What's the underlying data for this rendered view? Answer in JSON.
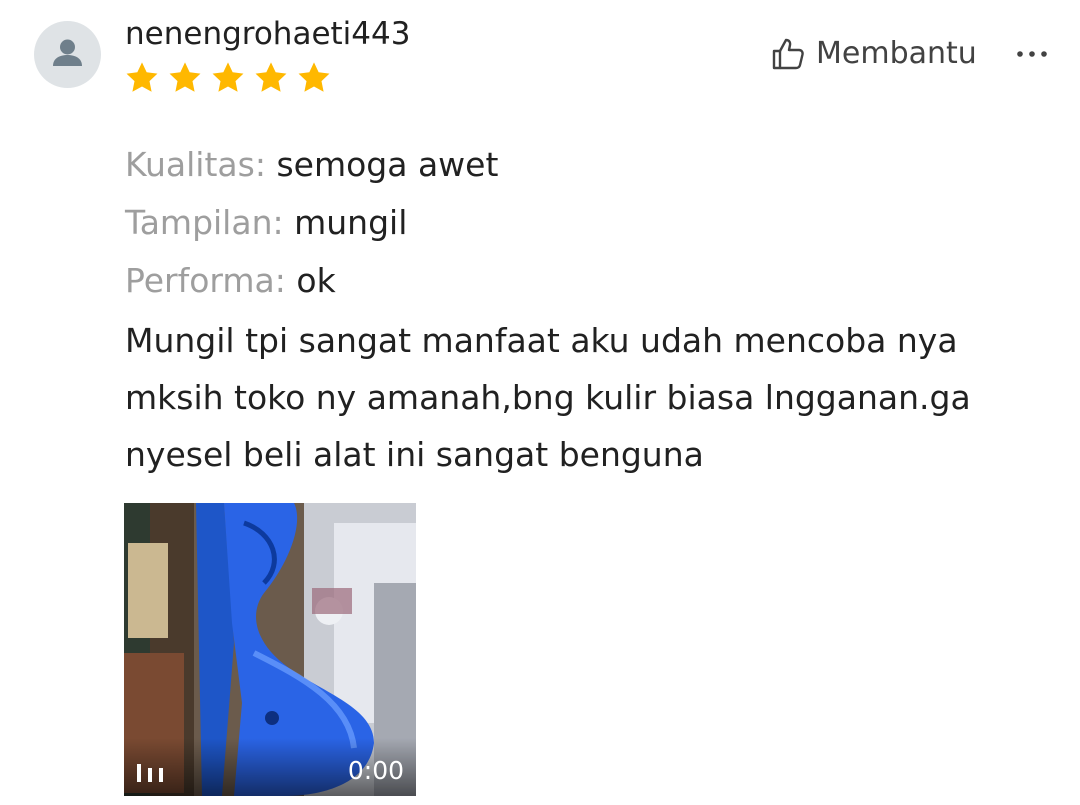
{
  "review": {
    "username": "nenengrohaeti443",
    "rating": 5,
    "rating_max": 5,
    "star_color": "#FFB800",
    "helpful_label": "Membantu",
    "attributes": [
      {
        "key": "Kualitas:",
        "value": "semoga awet"
      },
      {
        "key": "Tampilan:",
        "value": "mungil"
      },
      {
        "key": "Performa:",
        "value": "ok"
      }
    ],
    "text_lines": [
      "Mungil tpi sangat manfaat aku udah mencoba nya",
      "mksih toko ny amanah,bng kulir biasa lngganan.ga",
      "nyesel beli alat ini sangat benguna"
    ],
    "video": {
      "duration": "0:00",
      "icon": "video-icon"
    }
  },
  "icons": {
    "avatar": "user-icon",
    "helpful": "thumbs-up-icon",
    "more": "more-options-icon"
  },
  "colors": {
    "label_gray": "#9e9e9e",
    "text": "#212121",
    "avatar_bg": "#dfe3e6"
  }
}
